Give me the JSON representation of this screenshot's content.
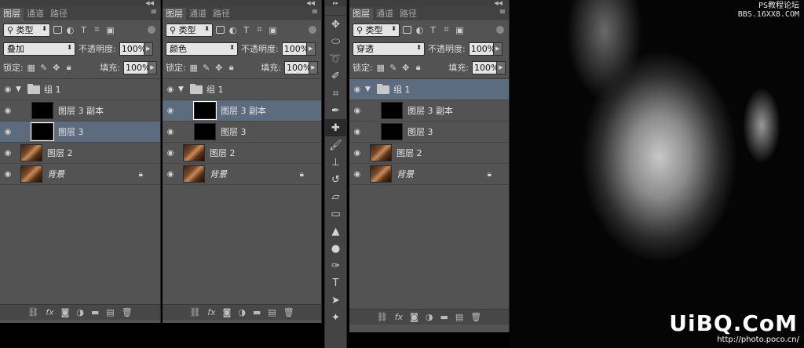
{
  "panel_tabs": [
    "图层",
    "通道",
    "路径"
  ],
  "filter": {
    "kind": "类型"
  },
  "labels": {
    "opacity": "不透明度:",
    "fill": "填充:",
    "lock": "锁定:"
  },
  "panels": [
    {
      "blend_mode": "叠加",
      "opacity": "100%",
      "fill": "100%",
      "layers": [
        {
          "name": "组 1",
          "type": "group"
        },
        {
          "name": "图层 3 副本",
          "type": "black",
          "indent": true
        },
        {
          "name": "图层 3",
          "type": "black",
          "indent": true,
          "selected": true
        },
        {
          "name": "图层 2",
          "type": "photo"
        },
        {
          "name": "背景",
          "type": "photo",
          "italic": true,
          "locked": true
        }
      ]
    },
    {
      "blend_mode": "颜色",
      "opacity": "100%",
      "fill": "100%",
      "layers": [
        {
          "name": "组 1",
          "type": "group"
        },
        {
          "name": "图层 3 副本",
          "type": "black",
          "indent": true,
          "selected": true
        },
        {
          "name": "图层 3",
          "type": "black",
          "indent": true
        },
        {
          "name": "图层 2",
          "type": "photo"
        },
        {
          "name": "背景",
          "type": "photo",
          "italic": true,
          "locked": true
        }
      ]
    },
    {
      "blend_mode": "穿透",
      "opacity": "100%",
      "fill": "100%",
      "layers": [
        {
          "name": "组 1",
          "type": "group",
          "selected": true
        },
        {
          "name": "图层 3 副本",
          "type": "black",
          "indent": true
        },
        {
          "name": "图层 3",
          "type": "black",
          "indent": true
        },
        {
          "name": "图层 2",
          "type": "photo"
        },
        {
          "name": "背景",
          "type": "photo",
          "italic": true,
          "locked": true
        }
      ]
    }
  ],
  "watermark": {
    "site_line1": "PS教程论坛",
    "site_line2": "BBS.16XX8.COM",
    "logo": "UiBQ.CoM",
    "url": "http://photo.poco.cn/"
  },
  "colors": {
    "panel": "#535353",
    "selection": "#5d6b7f",
    "toolbar": "#444444"
  }
}
